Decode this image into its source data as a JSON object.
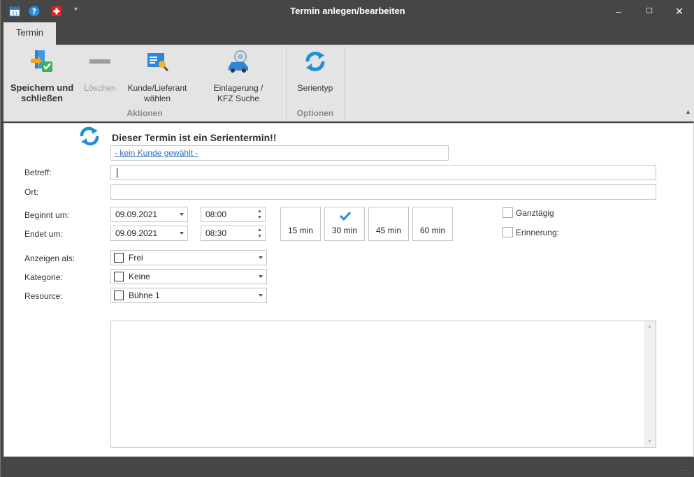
{
  "window": {
    "title": "Termin anlegen/bearbeiten",
    "minimize": "–",
    "maximize": "☐",
    "close": "✕"
  },
  "quick_access": {
    "calendar_day": "31",
    "help": "?",
    "dropdown": "▾"
  },
  "ribbon": {
    "tab": "Termin",
    "buttons": {
      "save_close": "Speichern und schließen",
      "delete": "Löschen",
      "customer": "Kunde/Lieferant wählen",
      "storage": "Einlagerung / KFZ Suche",
      "series": "Serientyp"
    },
    "groups": {
      "actions": "Aktionen",
      "options": "Optionen"
    },
    "collapse": "▴"
  },
  "form": {
    "series_notice": "Dieser Termin ist ein Serientermin!!",
    "customer_link": "- kein Kunde gewählt -",
    "labels": {
      "subject": "Betreff:",
      "location": "Ort:",
      "start": "Beginnt um:",
      "end": "Endet um:",
      "show_as": "Anzeigen als:",
      "category": "Kategorie:",
      "resource": "Resource:"
    },
    "values": {
      "subject": "",
      "location": "",
      "start_date": "09.09.2021",
      "start_time": "08:00",
      "end_date": "09.09.2021",
      "end_time": "08:30",
      "show_as": "Frei",
      "category": "Keine",
      "resource": "Bühne 1",
      "notes": ""
    },
    "durations": [
      {
        "label": "15 min",
        "selected": false
      },
      {
        "label": "30 min",
        "selected": true
      },
      {
        "label": "45 min",
        "selected": false
      },
      {
        "label": "60 min",
        "selected": false
      }
    ],
    "checkboxes": {
      "all_day": {
        "label": "Ganztägig",
        "checked": false
      },
      "reminder": {
        "label": "Erinnerung:",
        "checked": false
      }
    }
  },
  "colors": {
    "ribbon_bg": "#e4e4e4",
    "frame": "#464646",
    "accent": "#1f8fd6",
    "link": "#2f6fb7"
  }
}
